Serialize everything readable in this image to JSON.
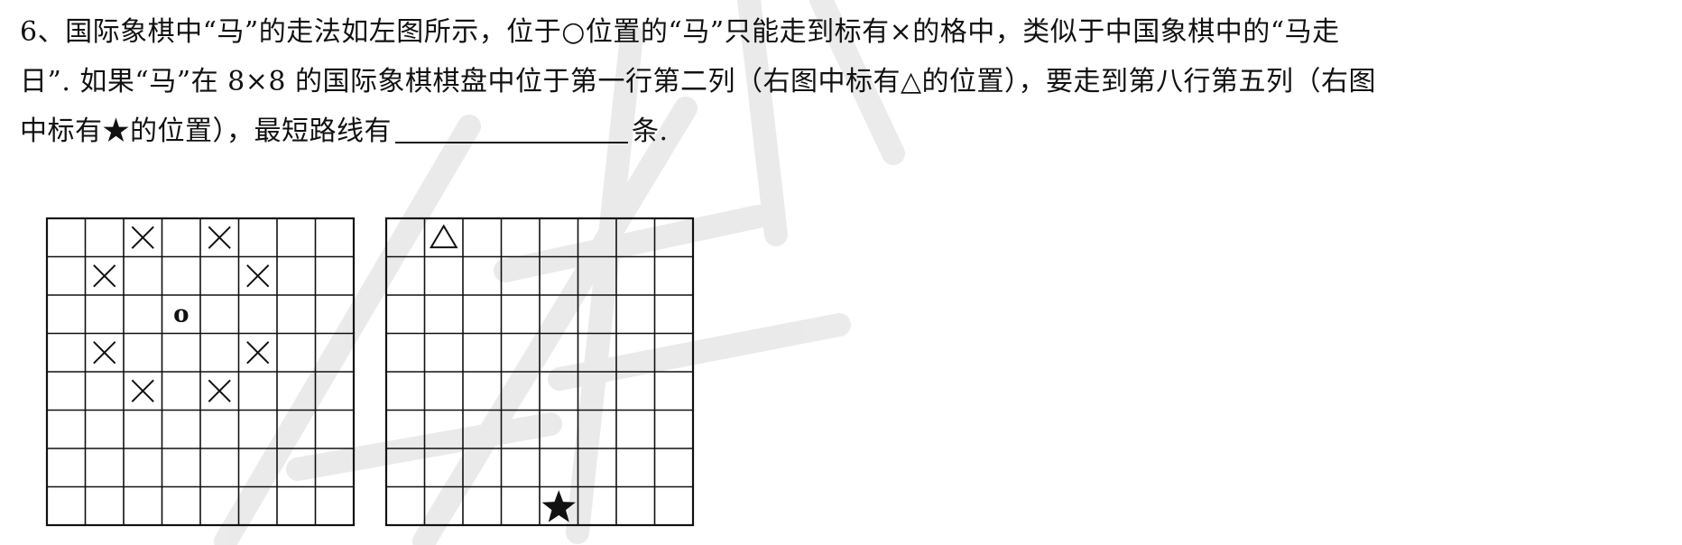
{
  "problem": {
    "line1": "6、国际象棋中“马”的走法如左图所示，位于○位置的“马”只能走到标有×的格中，类似于中国象棋中的“马走",
    "line2": "日”. 如果“马”在 8×8 的国际象棋棋盘中位于第一行第二列（右图中标有△的位置），要走到第八行第五列（右图",
    "line3_before": "中标有★的位置），最短路线有",
    "line3_after": "条."
  },
  "boards": {
    "size": 8,
    "left": {
      "knight": {
        "row": 3,
        "col": 4,
        "symbol": "o"
      },
      "moves": [
        {
          "row": 1,
          "col": 3,
          "symbol": "×"
        },
        {
          "row": 1,
          "col": 5,
          "symbol": "×"
        },
        {
          "row": 2,
          "col": 2,
          "symbol": "×"
        },
        {
          "row": 2,
          "col": 6,
          "symbol": "×"
        },
        {
          "row": 4,
          "col": 2,
          "symbol": "×"
        },
        {
          "row": 4,
          "col": 6,
          "symbol": "×"
        },
        {
          "row": 5,
          "col": 3,
          "symbol": "×"
        },
        {
          "row": 5,
          "col": 5,
          "symbol": "×"
        }
      ]
    },
    "right": {
      "start": {
        "row": 1,
        "col": 2,
        "symbol": "△"
      },
      "target": {
        "row": 8,
        "col": 5,
        "symbol": "★"
      }
    }
  },
  "colors": {
    "ink": "#111111",
    "watermark": "#d9d9d9"
  }
}
